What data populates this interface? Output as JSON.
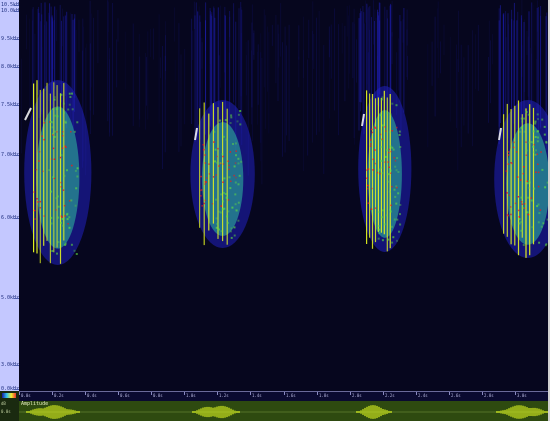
{
  "window": {
    "app": "Raven-style spectrogram viewer"
  },
  "frequency_axis": {
    "labels": [
      "10.5kHz",
      "10.0kHz",
      "9.5kHz",
      "8.0kHz",
      "7.5kHz",
      "7.0kHz",
      "6.0kHz",
      "5.0kHz",
      "3.0kHz",
      "0.0kHz"
    ]
  },
  "time_axis": {
    "labels": [
      "0.0s",
      "0.2s",
      "0.4s",
      "0.6s",
      "0.8s",
      "1.0s",
      "1.2s",
      "1.4s",
      "1.6s",
      "1.8s",
      "2.0s",
      "2.2s",
      "2.4s",
      "2.6s",
      "2.8s",
      "3.0s"
    ]
  },
  "waveform": {
    "label": "Amplitude"
  },
  "bottom_left": {
    "line1": "dB",
    "line2": "0.0s"
  },
  "colors": {
    "background": "#06061e",
    "low_energy": "#2020c0",
    "mid_energy": "#30c0a0",
    "high_energy": "#e0f020",
    "peak_energy": "#e02020",
    "waveform_fill": "#2e4a10",
    "waveform_trace": "#d8f020"
  }
}
